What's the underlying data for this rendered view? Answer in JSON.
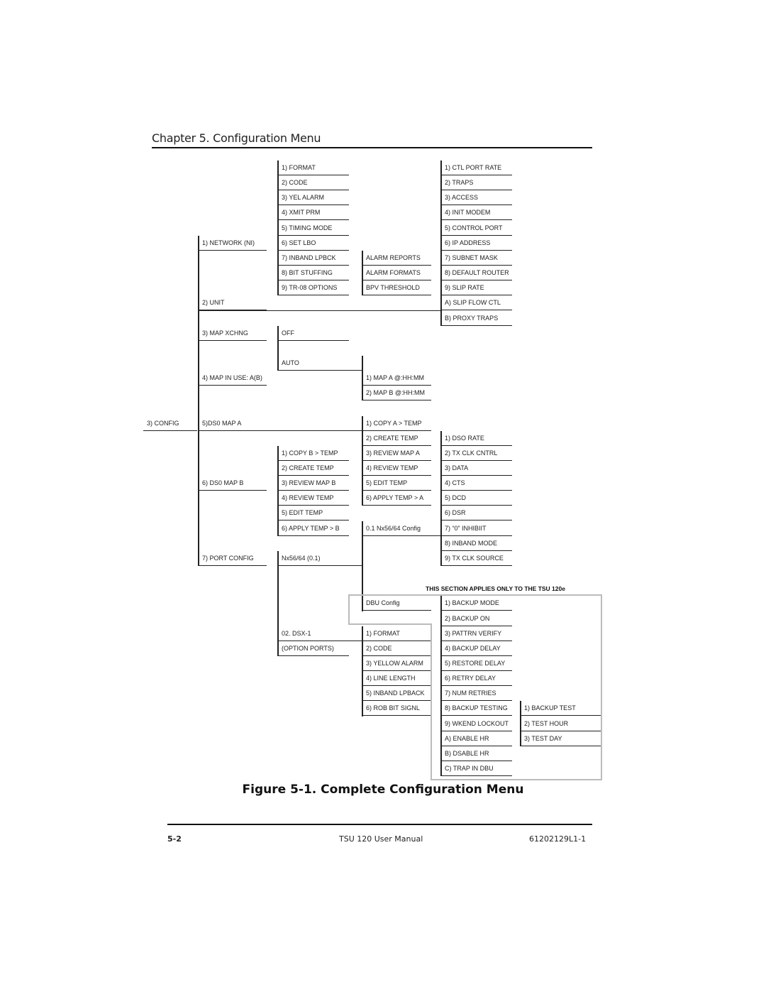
{
  "header": {
    "chapter_title": "Chapter 5. Configuration Menu"
  },
  "diagram": {
    "root": "3) CONFIG",
    "level1": [
      "1) NETWORK (NI)",
      "2) UNIT",
      "3) MAP XCHNG",
      "4) MAP IN USE: A(B)",
      "5)DS0 MAP A",
      "6) DS0 MAP B",
      "7) PORT CONFIG"
    ],
    "network_items": [
      "1) FORMAT",
      "2) CODE",
      "3) YEL ALARM",
      "4) XMIT PRM",
      "5) TIMING MODE",
      "6) SET LBO",
      "7) INBAND LPBCK",
      "8) BIT STUFFING",
      "9) TR-08 OPTIONS"
    ],
    "tr08_items": [
      "ALARM REPORTS",
      "ALARM FORMATS",
      "BPV THRESHOLD"
    ],
    "unit_items": [
      "1) CTL PORT RATE",
      "2) TRAPS",
      "3) ACCESS",
      "4) INIT MODEM",
      "5) CONTROL PORT",
      "6) IP ADDRESS",
      "7) SUBNET MASK",
      "8) DEFAULT ROUTER",
      "9) SLIP RATE",
      "A) SLIP FLOW CTL",
      "B) PROXY TRAPS"
    ],
    "map_xchng_items": [
      "OFF",
      "AUTO"
    ],
    "auto_items": [
      "1) MAP A @:HH:MM",
      "2) MAP B @:HH:MM"
    ],
    "ds0_map_a_items": [
      "1) COPY A > TEMP",
      "2) CREATE TEMP",
      "3) REVIEW MAP A",
      "4) REVIEW TEMP",
      "5) EDIT TEMP",
      "6) APPLY TEMP > A"
    ],
    "ds0_map_b_items": [
      "1) COPY B > TEMP",
      "2) CREATE TEMP",
      "3) REVIEW MAP B",
      "4) REVIEW TEMP",
      "5) EDIT TEMP",
      "6) APPLY TEMP > B"
    ],
    "port_config_items": [
      "Nx56/64 (0.1)",
      "02. DSX-1",
      "(OPTION PORTS)"
    ],
    "nx_items": [
      "0.1 Nx56/64 Config",
      "DBU Config"
    ],
    "nx_config_items": [
      "1) DSO RATE",
      "2) TX CLK CNTRL",
      "3) DATA",
      "4) CTS",
      "5) DCD",
      "6) DSR",
      "7) “0” INHIBIIT",
      "8) INBAND MODE",
      "9) TX CLK SOURCE"
    ],
    "dsx1_items": [
      "1) FORMAT",
      "2) CODE",
      "3) YELLOW ALARM",
      "4) LINE LENGTH",
      "5) INBAND LPBACK",
      "6) ROB BIT SIGNL"
    ],
    "dbu_items": [
      "1) BACKUP MODE",
      "2) BACKUP ON",
      "3) PATTRN VERIFY",
      "4) BACKUP DELAY",
      "5) RESTORE DELAY",
      "6) RETRY DELAY",
      "7) NUM RETRIES",
      "8) BACKUP TESTING",
      "9) WKEND LOCKOUT",
      "A) ENABLE HR",
      "B) DSABLE HR",
      "C) TRAP IN DBU"
    ],
    "backup_testing_items": [
      "1) BACKUP TEST",
      "2) TEST HOUR",
      "3) TEST DAY"
    ],
    "section_note": "THIS SECTION APPLIES ONLY TO THE TSU 120e"
  },
  "figure_caption": "Figure 5-1.  Complete Configuration Menu",
  "footer": {
    "page_number": "5-2",
    "manual_title": "TSU 120 User Manual",
    "document_number": "61202129L1-1"
  }
}
